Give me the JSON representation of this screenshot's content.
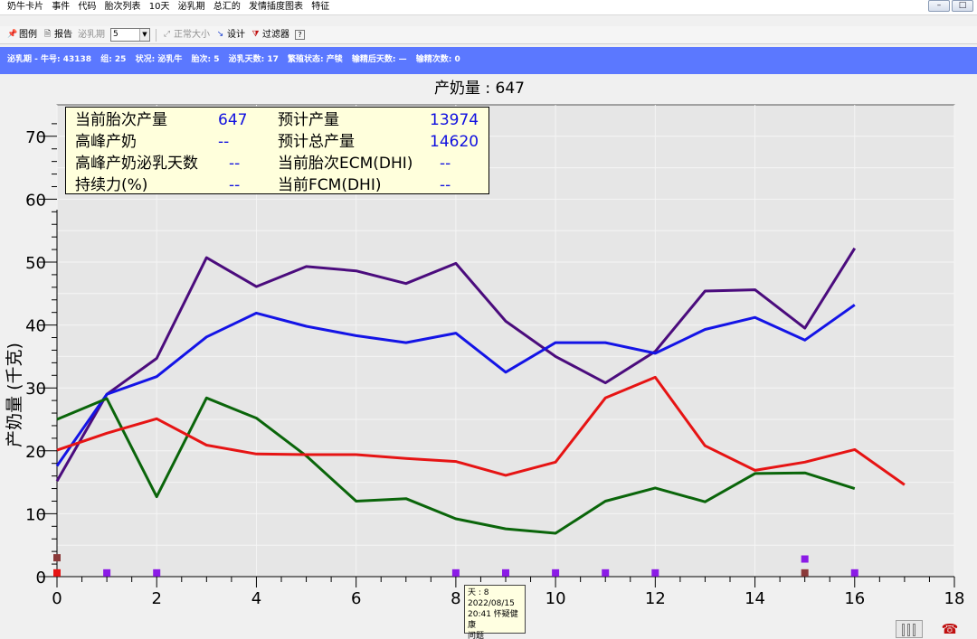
{
  "menu": [
    "奶牛卡片",
    "事件",
    "代码",
    "胎次列表",
    "10天",
    "泌乳期",
    "总汇的",
    "发情插度图表",
    "特征"
  ],
  "toolbar": {
    "chart_label": "图例",
    "report_label": "报告",
    "lactation_label": "泌乳期",
    "lactation_value": "5",
    "normal_size_label": "正常大小",
    "design_label": "设计",
    "filter_label": "过滤器",
    "help_label": "?"
  },
  "infobar": {
    "lactation_cow": "泌乳期 - 牛号: 43138",
    "group": "组: 25",
    "status": "状况: 泌乳牛",
    "parity": "胎次: 5",
    "dim": "泌乳天数: 17",
    "repro_status": "繁殖状态: 产犊",
    "days_after_breeding": "输精后天数: —",
    "breeding_count": "输精次数: 0"
  },
  "summary": {
    "current_lact_yield_label": "当前胎次产量",
    "current_lact_yield": "647",
    "expected_yield_label": "预计产量",
    "expected_yield": "13974",
    "peak_label": "高峰产奶",
    "peak": "--",
    "expected_total_label": "预计总产量",
    "expected_total": "14620",
    "peak_dim_label": "高峰产奶泌乳天数",
    "peak_dim": "--",
    "ecm_label": "当前胎次ECM(DHI)",
    "ecm": "--",
    "persistency_label": "持续力(%)",
    "persistency": "--",
    "fcm_label": "当前FCM(DHI)",
    "fcm": "--"
  },
  "tooltip": {
    "day": "天 : 8",
    "date": "2022/08/15",
    "event": "20:41 怀疑健康",
    "event2": "问题"
  },
  "chart_data": {
    "type": "line",
    "title": "产奶量 : 647",
    "xlabel": "",
    "ylabel": "产奶量 (千克)",
    "xlim": [
      0,
      18
    ],
    "ylim": [
      0,
      75
    ],
    "xticks": [
      0,
      2,
      4,
      6,
      8,
      10,
      12,
      14,
      16,
      18
    ],
    "yticks": [
      0,
      10,
      20,
      30,
      40,
      50,
      60,
      70
    ],
    "grid": true,
    "colors": {
      "plot_bg": "#e6e6e6",
      "purple": "#4b0c7d",
      "blue": "#1414e6",
      "green": "#0a650a",
      "red": "#e61414",
      "marker": "#8b1be6"
    },
    "series": [
      {
        "color": "#4b0c7d",
        "x": [
          0,
          1,
          2,
          3,
          4,
          5,
          6,
          7,
          8,
          9,
          10,
          11,
          12,
          13,
          14,
          15,
          16
        ],
        "y": [
          15.2,
          29.0,
          34.7,
          50.7,
          46.1,
          49.3,
          48.6,
          46.6,
          49.8,
          40.6,
          35.0,
          30.8,
          35.8,
          45.4,
          45.6,
          39.5,
          52.2
        ]
      },
      {
        "color": "#1414e6",
        "x": [
          0,
          1,
          2,
          3,
          4,
          5,
          6,
          7,
          8,
          9,
          10,
          11,
          12,
          13,
          14,
          15,
          16
        ],
        "y": [
          17.6,
          29.0,
          31.8,
          38.1,
          41.9,
          39.8,
          38.3,
          37.2,
          38.7,
          32.5,
          37.2,
          37.2,
          35.5,
          39.3,
          41.2,
          37.6,
          43.2
        ]
      },
      {
        "color": "#0a650a",
        "x": [
          0,
          1,
          2,
          3,
          4,
          5,
          6,
          7,
          8,
          9,
          10,
          11,
          12,
          13,
          14,
          15,
          16
        ],
        "y": [
          25.0,
          28.3,
          12.7,
          28.4,
          25.2,
          19.2,
          12.0,
          12.4,
          9.2,
          7.6,
          6.9,
          12.0,
          14.1,
          11.9,
          16.4,
          16.5,
          14.0
        ]
      },
      {
        "color": "#e61414",
        "x": [
          0,
          1,
          2,
          3,
          4,
          5,
          6,
          7,
          8,
          9,
          10,
          11,
          12,
          13,
          14,
          15,
          16,
          17
        ],
        "y": [
          20.1,
          22.8,
          25.1,
          20.9,
          19.5,
          19.4,
          19.4,
          18.8,
          18.3,
          16.1,
          18.2,
          28.4,
          31.7,
          20.8,
          16.9,
          18.2,
          20.2,
          14.6
        ]
      }
    ],
    "event_markers": [
      {
        "x": 0,
        "y": 3,
        "color": "#8b3a3a"
      },
      {
        "x": 0,
        "y": 0.6,
        "color": "#e61414"
      },
      {
        "x": 1,
        "y": 0.6,
        "color": "#8b1be6"
      },
      {
        "x": 2,
        "y": 0.6,
        "color": "#8b1be6"
      },
      {
        "x": 8,
        "y": 0.6,
        "color": "#8b1be6"
      },
      {
        "x": 9,
        "y": 0.6,
        "color": "#8b1be6"
      },
      {
        "x": 10,
        "y": 0.6,
        "color": "#8b1be6"
      },
      {
        "x": 11,
        "y": 0.6,
        "color": "#8b1be6"
      },
      {
        "x": 12,
        "y": 0.6,
        "color": "#8b1be6"
      },
      {
        "x": 15,
        "y": 2.8,
        "color": "#8b1be6"
      },
      {
        "x": 15,
        "y": 0.6,
        "color": "#8b3a3a"
      },
      {
        "x": 16,
        "y": 0.6,
        "color": "#8b1be6"
      }
    ]
  }
}
